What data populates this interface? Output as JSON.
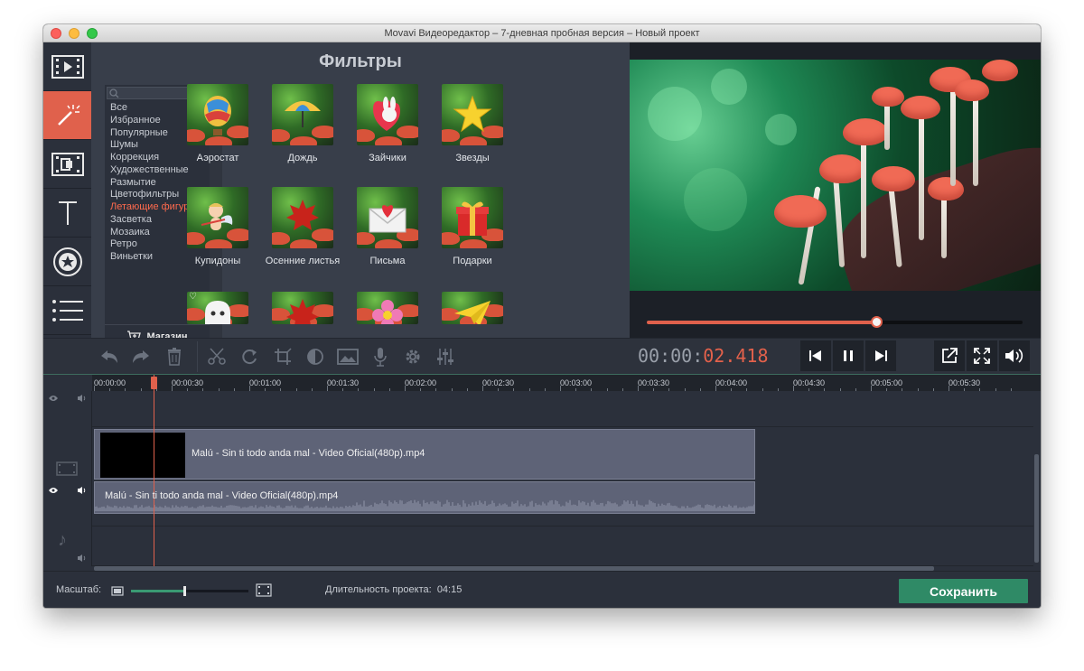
{
  "window": {
    "title": "Movavi Видеоредактор – 7-дневная пробная версия – Новый проект"
  },
  "sidebar": {
    "items": [
      {
        "icon": "import-media-icon"
      },
      {
        "icon": "filters-magic-wand-icon",
        "active": true
      },
      {
        "icon": "transitions-icon"
      },
      {
        "icon": "titles-text-icon"
      },
      {
        "icon": "stickers-star-icon"
      },
      {
        "icon": "more-tools-list-icon"
      }
    ]
  },
  "filters": {
    "title": "Фильтры",
    "categories": [
      "Все",
      "Избранное",
      "Популярные",
      "Шумы",
      "Коррекция",
      "Художественные",
      "Размытие",
      "Цветофильтры",
      "Летающие фигуры",
      "Засветка",
      "Мозаика",
      "Ретро",
      "Виньетки"
    ],
    "active_category": "Летающие фигуры",
    "store_label": "Магазин",
    "items": [
      {
        "label": "Аэростат",
        "icon": "balloon-icon"
      },
      {
        "label": "Дождь",
        "icon": "umbrella-icon"
      },
      {
        "label": "Зайчики",
        "icon": "bunny-icon"
      },
      {
        "label": "Звезды",
        "icon": "star-icon"
      },
      {
        "label": "Купидоны",
        "icon": "cupid-icon"
      },
      {
        "label": "Осенние листья",
        "icon": "leaf-icon"
      },
      {
        "label": "Письма",
        "icon": "envelope-icon"
      },
      {
        "label": "Подарки",
        "icon": "gift-icon"
      },
      {
        "label": "",
        "icon": "ghost-icon"
      },
      {
        "label": "",
        "icon": "leaf-icon"
      },
      {
        "label": "",
        "icon": "flower-icon"
      },
      {
        "label": "",
        "icon": "paper-plane-icon"
      }
    ]
  },
  "player": {
    "timecode_dim": "00:00:",
    "timecode_active": "02.418",
    "progress": 0.61
  },
  "timeline": {
    "ruler": [
      "00:00:00",
      "00:00:30",
      "00:01:00",
      "00:01:30",
      "00:02:00",
      "00:02:30",
      "00:03:00",
      "00:03:30",
      "00:04:00",
      "00:04:30",
      "00:05:00",
      "00:05:30"
    ],
    "video_clip_label": "Malú - Sin ti todo anda mal - Video Oficial(480p).mp4",
    "audio_clip_label": "Malú - Sin ti todo anda mal - Video Oficial(480p).mp4"
  },
  "bottom": {
    "zoom_label": "Масштаб:",
    "zoom_level": 0.45,
    "duration_label": "Длительность проекта:",
    "duration_value": "04:15",
    "save_label": "Сохранить"
  },
  "colors": {
    "accent": "#e0614c",
    "save": "#2f8a66",
    "panel": "#383e4a",
    "background": "#2b303b"
  }
}
